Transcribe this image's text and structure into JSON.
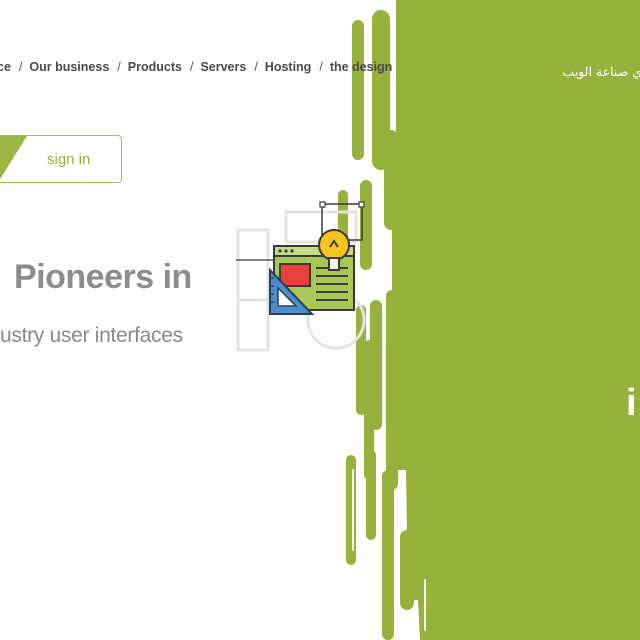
{
  "nav": {
    "items": [
      {
        "label": "ce"
      },
      {
        "label": "Our business"
      },
      {
        "label": "Products"
      },
      {
        "label": "Servers"
      },
      {
        "label": "Hosting"
      },
      {
        "label": "the design"
      }
    ],
    "separator": "/"
  },
  "signin": {
    "label": "sign in"
  },
  "hero": {
    "headline": "Pioneers in",
    "subline": "ustry user interfaces"
  },
  "green_panel": {
    "arabic_text": "ي صناعة الويب",
    "glyph": "i"
  },
  "colors": {
    "accent_green": "#9bb544",
    "panel_green": "#97b13d",
    "text_gray": "#8d8d8d",
    "nav_text": "#4a4a4a"
  },
  "icons": {
    "design": "design-tools-icon",
    "lightbulb": "lightbulb-icon",
    "set_square": "set-square-icon"
  }
}
